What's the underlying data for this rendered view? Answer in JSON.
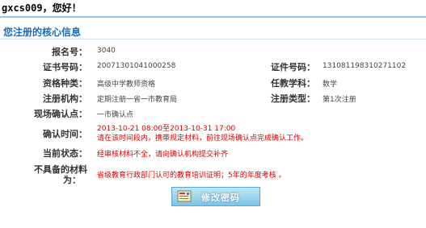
{
  "greeting": {
    "user": "gxcs009",
    "suffix": "，您好！"
  },
  "section_title": "您注册的核心信息",
  "fields": {
    "reg_no": {
      "label": "报名号：",
      "value": "3040"
    },
    "cert_no": {
      "label": "证书号码：",
      "value": "20071301041000258"
    },
    "id_no": {
      "label": "证件号码：",
      "value": "131081198310271102"
    },
    "qual_type": {
      "label": "资格种类：",
      "value": "高级中学教师资格"
    },
    "subject": {
      "label": "任教学科：",
      "value": "数学"
    },
    "reg_org": {
      "label": "注册机构：",
      "value": "定期注册一省一市教育局"
    },
    "reg_type": {
      "label": "注册类型：",
      "value": "第1次注册"
    },
    "confirm_point": {
      "label": "现场确认点：",
      "value": "一市确认点"
    },
    "confirm_time": {
      "label": "确认时间：",
      "value_time": "2013-10-21 08:00至2013-10-31 17:00",
      "value_note": "请在该时间段内，携带规定材料，前往现场确认点完成确认工作。"
    },
    "status": {
      "label": "当前状态：",
      "value": "经审核材料不全，请向确认机构提交补齐"
    },
    "missing": {
      "label_line1": "不具备的材料",
      "label_line2": "为：",
      "value": "省级教育行政部门认可的教育培训证明；5年的年度考核 。"
    }
  },
  "button": {
    "label": "修改密码",
    "icon": "form-edit-icon"
  },
  "colors": {
    "title_blue": "#1f6bb0",
    "alert_red": "#d40000",
    "button_blue": "#7cc4e6"
  }
}
